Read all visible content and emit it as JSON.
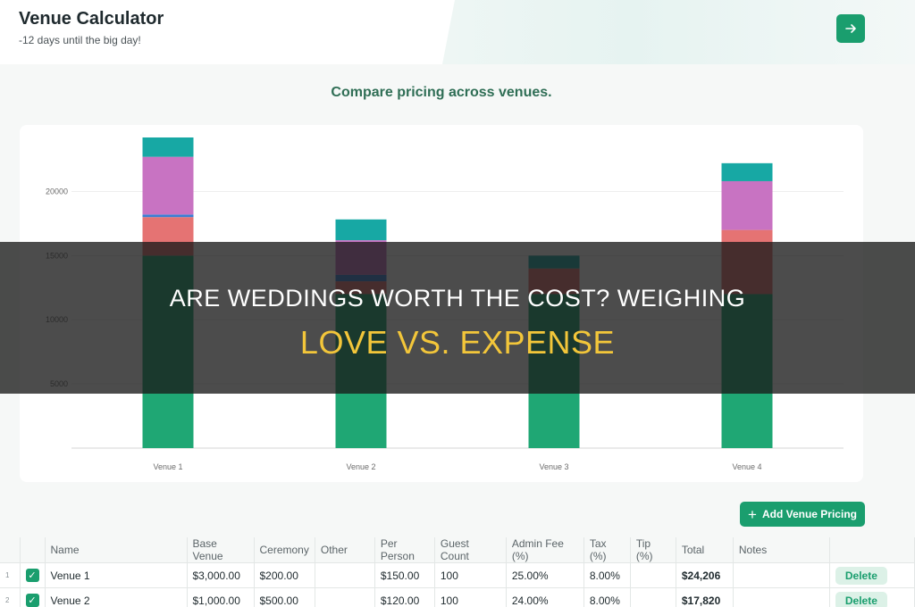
{
  "header": {
    "title": "Venue Calculator",
    "subtitle": "-12 days until the big day!",
    "go_icon": "arrow-right-icon"
  },
  "chart_heading": "Compare pricing across venues.",
  "chart_data": {
    "type": "bar",
    "stacked": true,
    "categories": [
      "Venue 1",
      "Venue 2",
      "Venue 3",
      "Venue 4"
    ],
    "series": [
      {
        "color": "#1fa774",
        "values": [
          15000,
          12000,
          12000,
          12000
        ]
      },
      {
        "color": "#e57373",
        "values": [
          3000,
          1000,
          2000,
          5000
        ]
      },
      {
        "color": "#3a7fd5",
        "values": [
          200,
          500,
          0,
          0
        ]
      },
      {
        "color": "#c873c2",
        "values": [
          4500,
          2700,
          0,
          3800
        ]
      },
      {
        "color": "#17a8a4",
        "values": [
          1506,
          1620,
          1000,
          1400
        ]
      }
    ],
    "ylim": [
      0,
      24206
    ],
    "yticks": [
      5000,
      10000,
      15000,
      20000
    ],
    "ytick_labels": [
      "5000",
      "10000",
      "15000",
      "20000"
    ],
    "grid": true
  },
  "add_button": {
    "label": "Add Venue Pricing",
    "icon": "plus-icon"
  },
  "table": {
    "columns": [
      "Name",
      "Base Venue",
      "Ceremony",
      "Other",
      "Per Person",
      "Guest Count",
      "Admin Fee (%)",
      "Tax (%)",
      "Tip (%)",
      "Total",
      "Notes"
    ],
    "rows": [
      {
        "num": "1",
        "name": "Venue 1",
        "base": "$3,000.00",
        "ceremony": "$200.00",
        "other": "",
        "per_person": "$150.00",
        "guests": "100",
        "admin": "25.00%",
        "tax": "8.00%",
        "tip": "",
        "total": "$24,206",
        "notes": "",
        "delete": "Delete"
      },
      {
        "num": "2",
        "name": "Venue 2",
        "base": "$1,000.00",
        "ceremony": "$500.00",
        "other": "",
        "per_person": "$120.00",
        "guests": "100",
        "admin": "24.00%",
        "tax": "8.00%",
        "tip": "",
        "total": "$17,820",
        "notes": "",
        "delete": "Delete"
      }
    ]
  },
  "banner": {
    "line1": "ARE WEDDINGS WORTH THE COST? WEIGHING",
    "line2": "LOVE VS. EXPENSE"
  }
}
